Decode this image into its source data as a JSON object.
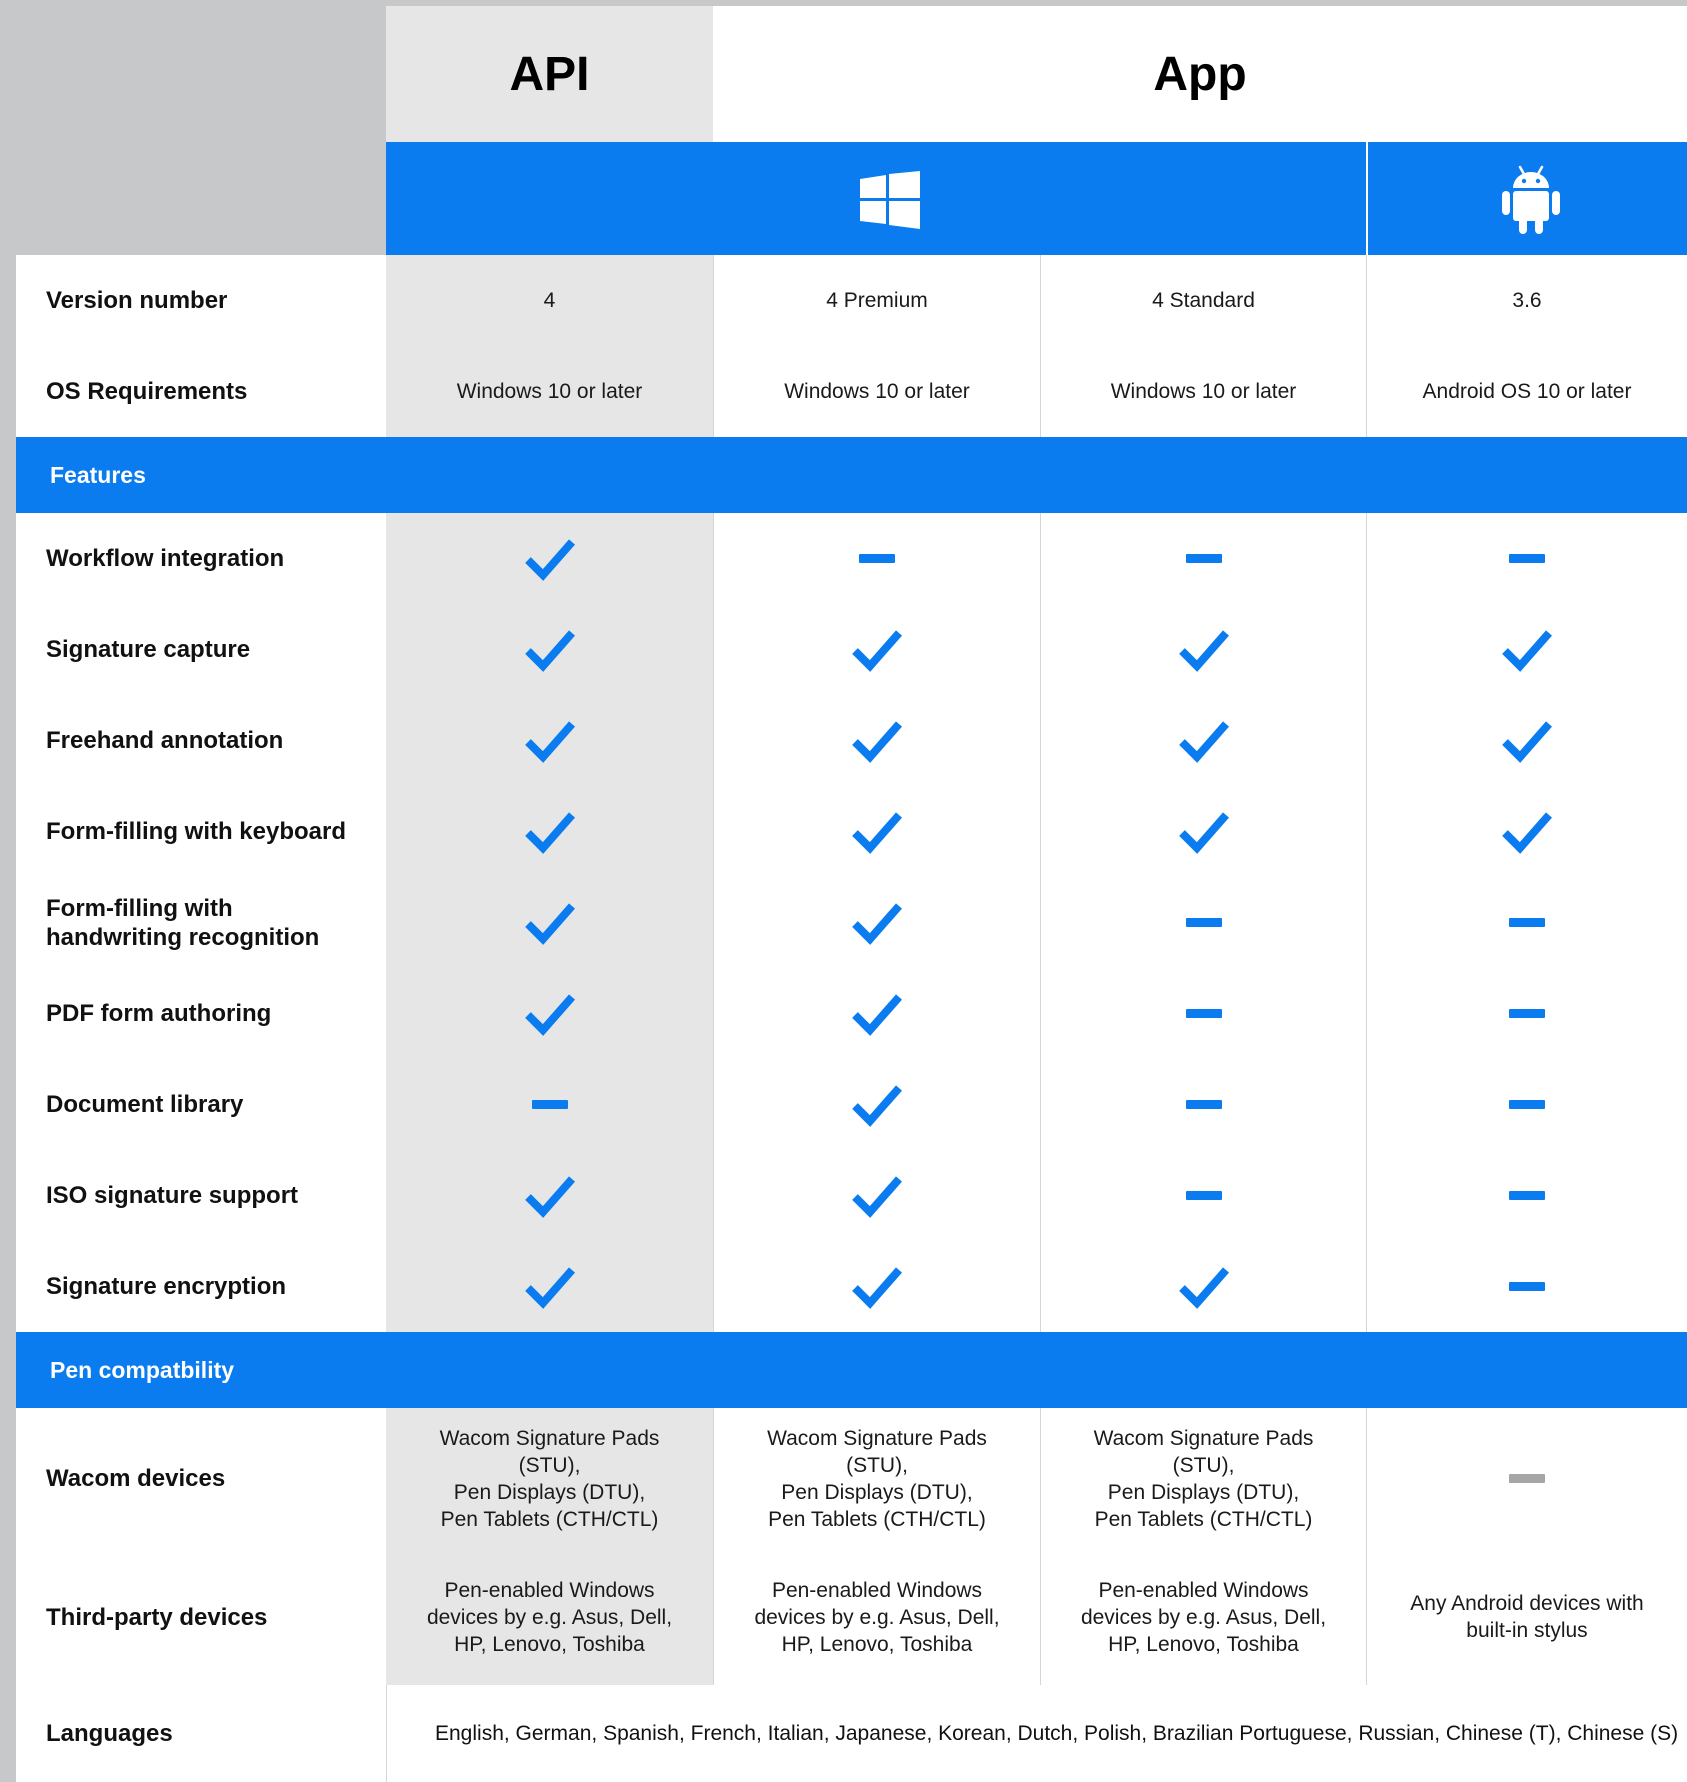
{
  "header": {
    "api_title": "API",
    "app_title": "App"
  },
  "platforms": {
    "windows_icon": "windows-logo-icon",
    "android_icon": "android-logo-icon"
  },
  "colors": {
    "accent": "#0a7cf0",
    "api_column_bg": "#e6e6e7",
    "page_bg": "#c7c8ca"
  },
  "rows_top": [
    {
      "label": "Version number",
      "values": [
        "4",
        "4 Premium",
        "4 Standard",
        "3.6"
      ]
    },
    {
      "label": "OS Requirements",
      "values": [
        "Windows 10 or later",
        "Windows 10 or later",
        "Windows 10 or later",
        "Android OS 10 or later"
      ]
    }
  ],
  "sections": {
    "features": "Features",
    "pen": "Pen compatbility"
  },
  "features": [
    {
      "label": "Workflow integration",
      "values": [
        "check",
        "dash",
        "dash",
        "dash"
      ]
    },
    {
      "label": "Signature capture",
      "values": [
        "check",
        "check",
        "check",
        "check"
      ]
    },
    {
      "label": "Freehand annotation",
      "values": [
        "check",
        "check",
        "check",
        "check"
      ]
    },
    {
      "label": "Form-filling with keyboard",
      "values": [
        "check",
        "check",
        "check",
        "check"
      ]
    },
    {
      "label": "Form-filling with\nhandwriting recognition",
      "values": [
        "check",
        "check",
        "dash",
        "dash"
      ]
    },
    {
      "label": "PDF form authoring",
      "values": [
        "check",
        "check",
        "dash",
        "dash"
      ]
    },
    {
      "label": "Document library",
      "values": [
        "dash",
        "check",
        "dash",
        "dash"
      ]
    },
    {
      "label": "ISO signature support",
      "values": [
        "check",
        "check",
        "dash",
        "dash"
      ]
    },
    {
      "label": "Signature encryption",
      "values": [
        "check",
        "check",
        "check",
        "dash"
      ]
    }
  ],
  "pen_rows": [
    {
      "label": "Wacom devices",
      "values": [
        "Wacom Signature Pads\n(STU),\nPen Displays (DTU),\nPen Tablets (CTH/CTL)",
        "Wacom Signature Pads\n(STU),\nPen Displays (DTU),\nPen Tablets (CTH/CTL)",
        "Wacom Signature Pads\n(STU),\nPen Displays (DTU),\nPen Tablets (CTH/CTL)",
        "dash-grey"
      ]
    },
    {
      "label": "Third-party devices",
      "values": [
        "Pen-enabled Windows\ndevices by e.g. Asus, Dell,\nHP, Lenovo, Toshiba",
        "Pen-enabled Windows\ndevices by e.g. Asus, Dell,\nHP, Lenovo, Toshiba",
        "Pen-enabled Windows\ndevices by e.g. Asus, Dell,\nHP, Lenovo, Toshiba",
        "Any Android devices with\nbuilt-in stylus"
      ]
    }
  ],
  "languages": {
    "label": "Languages",
    "value": "English, German, Spanish, French, Italian, Japanese, Korean, Dutch, Polish, Brazilian Portuguese, Russian, Chinese (T), Chinese (S)"
  }
}
